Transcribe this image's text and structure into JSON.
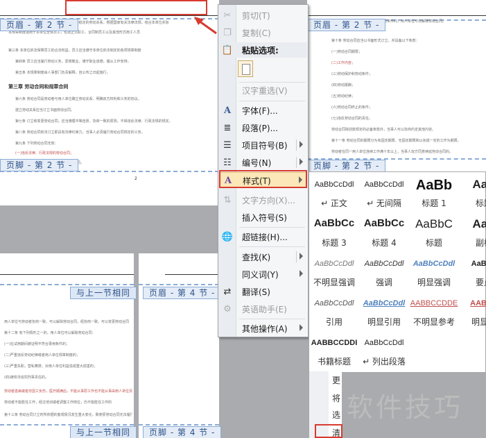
{
  "header_tabs": {
    "p2_header_left": "页眉 - 第 2 节 -",
    "p2_footer_left": "页脚 - 第 2 节 -",
    "p2_header_right": "页眉 - 第 2 节 -",
    "p2_footer_right": "页脚 - 第 2 节 -",
    "same_as_prev_top": "与上一节相同",
    "p4_header": "页眉 - 第 4 节 -",
    "same_as_prev_bottom": "与上一节相同",
    "p4_footer": "页脚 - 第 4 节 -"
  },
  "page_number": "2",
  "doc_left": {
    "lines": [
      "第二条 为了规范本单位的劳动管理，建立和谐稳定的劳动关系，根据国家有关法律法规，结合本单位实际",
      "本规章制度适用于本单位全体员工，包括正式职工、合同制员工以及其他形式用工人员",
      "第三条 本单位依法保障员工的合法权益，员工应当遵守本单位依法制定的各项规章制度",
      "第四条 员工应当履行劳动义务，爱岗敬业，遵守职业道德，服从工作安排。",
      "第五条 本规章制度由人事部门负责解释，自公布之日起施行。"
    ],
    "chapter": "第三章 劳动合同和规章合同",
    "lines2": [
      "第六条 劳动合同是劳动者与用人单位确立劳动关系、明确双方权利和义务的协议。",
      "建立劳动关系应当订立书面劳动合同。",
      "第七条 订立和变更劳动合同，应当遵循平等自愿、协商一致的原则，不得违反法律、行政法规的规定。",
      "第八条 劳动合同依法订立即具有法律约束力，当事人必须履行劳动合同规定的义务。",
      "第九条 下列劳动合同无效：",
      "(一)违反法律、行政法规的劳动合同；",
      "(二)采取欺诈、威胁等手段订立的劳动合同。"
    ]
  },
  "doc_right": {
    "lines": [
      "劳动者在试用期间被证明不符合录用条件的，用人单位可以解除劳动合同。",
      "第十条 劳动合同应当以书面形式订立，并具备以下条款：",
      "(一)劳动合同期限；",
      "(二)工作内容；",
      "(三)劳动保护和劳动条件；",
      "(四)劳动报酬；",
      "(五)劳动纪律；",
      "(六)劳动合同终止的条件；",
      "(七)违反劳动合同的责任。",
      "劳动合同除前款规定的必备条款外，当事人可以协商约定其他内容。",
      "第十一条 劳动合同的期限分为有固定期限、无固定期限和以完成一定的工作为期限。",
      "劳动者在同一用人单位连续工作满十年以上，当事人双方同意续延劳动合同的。"
    ]
  },
  "doc_bottom_left": {
    "lines": [
      "用人单位与劳动者协商一致，可以解除劳动合同，经协商一致，可以变更劳动合同",
      "第十二条 有下列情形之一的，用人单位可以解除劳动合同：",
      "(一)在试用期间被证明不符合录用条件的；",
      "(二)严重违反劳动纪律或者用人单位规章制度的；",
      "(三)严重失职，营私舞弊，对用人单位利益造成重大损害的；",
      "(四)被依法追究刑事责任的。",
      "劳动者患病或者非因工负伤，医疗期满后，不能从事原工作也不能从事由用人单位另行安排的工作",
      "劳动者不能胜任工作，经过培训或者调整工作岗位，仍不能胜任工作的",
      "第十三条 劳动合同订立时所依据的客观情况发生重大变化，致使原劳动合同无法履行"
    ]
  },
  "context_menu": {
    "cut": "剪切(T)",
    "copy": "复制(C)",
    "paste_options": "粘贴选项:",
    "reconvert": "汉字重选(V)",
    "font": "字体(F)...",
    "paragraph": "段落(P)...",
    "bullets": "项目符号(B)",
    "numbering": "编号(N)",
    "styles": "样式(T)",
    "text_direction": "文字方向(X)...",
    "insert_symbol": "插入符号(S)",
    "hyperlink": "超链接(H)...",
    "lookup": "查找(K)",
    "synonyms": "同义词(Y)",
    "translate": "翻译(S)",
    "english_assistant": "英语助手(E)",
    "other_actions": "其他操作(A)"
  },
  "styles_gallery": [
    {
      "preview": "AaBbCcDdl",
      "name": "↵ 正文",
      "color": "#222222"
    },
    {
      "preview": "AaBbCcDdl",
      "name": "↵ 无间隔",
      "color": "#222222"
    },
    {
      "preview": "AaBb",
      "name": "标题 1",
      "color": "#111111"
    },
    {
      "preview": "AaE",
      "name": "标题",
      "color": "#222222"
    },
    {
      "preview": "AaBbCc",
      "name": "标题 3",
      "color": "#222222"
    },
    {
      "preview": "AaBbCc",
      "name": "标题 4",
      "color": "#222222"
    },
    {
      "preview": "AaBbC",
      "name": "标题",
      "color": "#222222"
    },
    {
      "preview": "AaE",
      "name": "副标",
      "color": "#222222"
    },
    {
      "preview": "AaBbCcDdl",
      "name": "不明显强调",
      "color": "#777777"
    },
    {
      "preview": "AaBbCcDdl",
      "name": "强调",
      "color": "#333333"
    },
    {
      "preview": "AaBbCcDdl",
      "name": "明显强调",
      "color": "#4f81bd"
    },
    {
      "preview": "AaBbC",
      "name": "要点",
      "color": "#222222"
    },
    {
      "preview": "AaBbCcDdl",
      "name": "引用",
      "color": "#555555"
    },
    {
      "preview": "AaBbCcDdl",
      "name": "明显引用",
      "color": "#4f81bd"
    },
    {
      "preview": "AABBCCDDE",
      "name": "不明显参考",
      "color": "#c0504d"
    },
    {
      "preview": "AABBC",
      "name": "明显参",
      "color": "#c0504d"
    },
    {
      "preview": "AABBCCDDI",
      "name": "书籍标题",
      "color": "#222222"
    },
    {
      "preview": "AaBbCcDdl",
      "name": "↵ 列出段落",
      "color": "#222222"
    }
  ],
  "lower_panel": [
    "更",
    "将",
    "选",
    "清"
  ],
  "watermark": "软件技巧",
  "colors": {
    "highlight_red": "#d83a2f",
    "tab_text": "#2d5289",
    "menu_highlight": "#fbe7b8"
  }
}
